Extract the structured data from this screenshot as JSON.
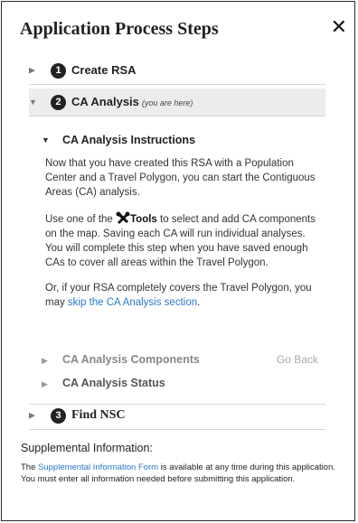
{
  "header": {
    "title": "Application Process Steps",
    "close_glyph": "✕"
  },
  "steps": [
    {
      "number": "1",
      "label": "Create RSA",
      "expanded": false,
      "active": false
    },
    {
      "number": "2",
      "label": "CA Analysis",
      "note": "(you are here)",
      "expanded": true,
      "active": true
    },
    {
      "number": "3",
      "label": "Find NSC",
      "expanded": false,
      "active": false
    }
  ],
  "ca_analysis": {
    "instructions_title": "CA Analysis Instructions",
    "para1": "Now that you have created this RSA with a Population Center and a Travel Polygon, you can start the Contiguous Areas (CA) analysis.",
    "para2_before": "Use one of the ",
    "para2_tools": "Tools",
    "para2_after": " to select and add CA components on the map. Saving each CA will run individual analyses. You will complete this step when you have saved enough CAs to cover all areas within the Travel Polygon.",
    "para3_before": "Or, if your RSA completely covers the Travel Polygon, you may ",
    "para3_link": "skip the CA Analysis section",
    "para3_after": ".",
    "components_title": "CA Analysis Components",
    "go_back": "Go Back",
    "status_title": "CA Analysis Status"
  },
  "supplemental": {
    "heading": "Supplemental Information:",
    "text_before": "The ",
    "link": "Supplemental Information Form",
    "text_after": " is available at any time during this application. You must enter all information needed before submitting this application."
  },
  "icons": {
    "collapsed": "chevron-right-icon",
    "expanded": "chevron-down-icon",
    "tools": "tools-icon",
    "close": "close-icon"
  },
  "colors": {
    "link": "#2878c8",
    "active_row": "#ececec",
    "dim_text": "#888888"
  }
}
